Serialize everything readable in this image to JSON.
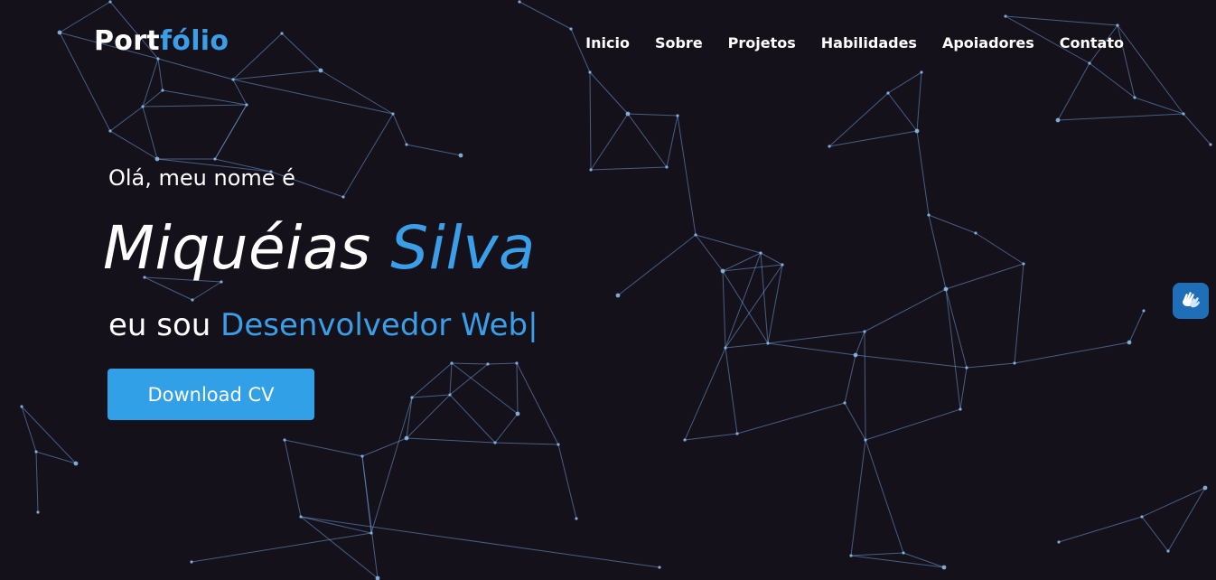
{
  "header": {
    "logo_part1": "Port",
    "logo_part2": "fólio",
    "nav": [
      "Inicio",
      "Sobre",
      "Projetos",
      "Habilidades",
      "Apoiadores",
      "Contato"
    ]
  },
  "hero": {
    "greeting": "Olá, meu nome é",
    "first_name": "Miquéias",
    "last_name": "Silva",
    "role_prefix": "eu sou",
    "role_highlight": "Desenvolvedor Web",
    "cursor": "|",
    "download_label": "Download CV"
  },
  "accessibility": {
    "icon": "sign-language-hands-icon"
  },
  "colors": {
    "background": "#14111b",
    "accent": "#3a9ee8",
    "button": "#31a0e6",
    "network_line": "#6f9fd8",
    "access_button": "#1f6fb8"
  }
}
